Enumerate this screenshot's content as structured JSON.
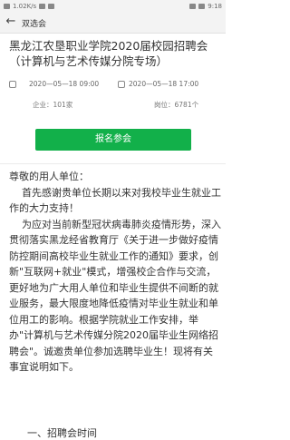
{
  "status_bar": {
    "network_speed": "1.02K/s",
    "time": "9:18"
  },
  "top_bar": {
    "title": "双选会"
  },
  "event": {
    "title": "黑龙江农垦职业学院2020届校园招聘会（计算机与艺术传媒分院专场）",
    "start": "2020—05—18 09:00",
    "end": "2020—05—18 17:00",
    "company_count": "企业：101家",
    "position_count": "岗位：6781个",
    "register_label": "报名参会"
  },
  "article": {
    "text": "尊敬的用人单位：\n    首先感谢贵单位长期以来对我校毕业生就业工作的大力支持！\n    为应对当前新型冠状病毒肺炎疫情形势，深入贯彻落实黑龙经省教育厅《关于进一步做好疫情防控期间高校毕业生就业工作的通知》要求，创新\"互联网+就业\"模式，增强校企合作与交流，更好地为广大用人单位和毕业生提供不间断的就业服务，最大限度地降低疫情对毕业生就业和单位用工的影响。根据学院就业工作安排，举办\"计算机与艺术传媒分院2020届毕业生网络招聘会\"。诚邀贵单位参加选聘毕业生！现将有关事宜说明如下。",
    "next_section": "一、招聘会时间"
  }
}
